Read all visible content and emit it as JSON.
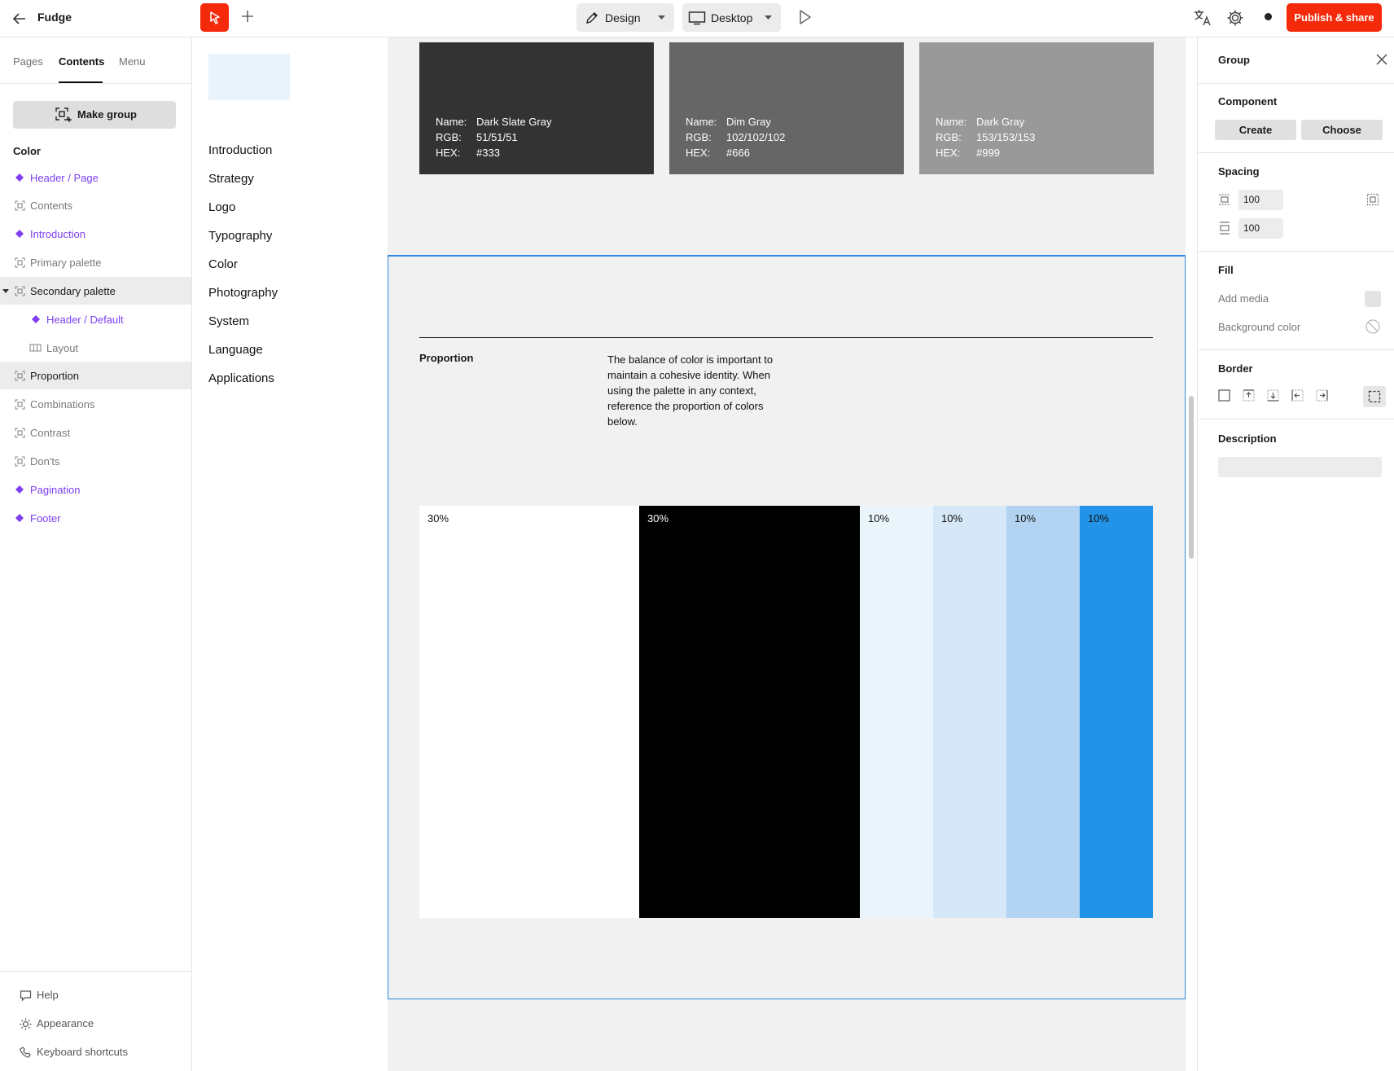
{
  "app": {
    "title": "Fudge"
  },
  "toolbar": {
    "design_label": "Design",
    "desktop_label": "Desktop",
    "publish_label": "Publish & share"
  },
  "sidebar": {
    "tabs": [
      {
        "label": "Pages"
      },
      {
        "label": "Contents"
      },
      {
        "label": "Menu"
      }
    ],
    "active_tab": "Contents",
    "make_group_label": "Make group",
    "section_label": "Color",
    "items": [
      {
        "label": "Header / Page",
        "kind": "component"
      },
      {
        "label": "Contents",
        "kind": "group"
      },
      {
        "label": "Introduction",
        "kind": "component"
      },
      {
        "label": "Primary palette",
        "kind": "group"
      },
      {
        "label": "Secondary palette",
        "kind": "group",
        "expanded": true
      },
      {
        "label": "Header / Default",
        "kind": "component"
      },
      {
        "label": "Layout",
        "kind": "layout"
      },
      {
        "label": "Proportion",
        "kind": "group",
        "selected": true
      },
      {
        "label": "Combinations",
        "kind": "group"
      },
      {
        "label": "Contrast",
        "kind": "group"
      },
      {
        "label": "Don'ts",
        "kind": "group"
      },
      {
        "label": "Pagination",
        "kind": "component"
      },
      {
        "label": "Footer",
        "kind": "component"
      }
    ],
    "bottom": [
      {
        "label": "Help",
        "icon": "help-icon"
      },
      {
        "label": "Appearance",
        "icon": "sun-icon"
      },
      {
        "label": "Keyboard shortcuts",
        "icon": "keyboard-icon"
      }
    ]
  },
  "site_nav": {
    "links": [
      "Introduction",
      "Strategy",
      "Logo",
      "Typography",
      "Color",
      "Photography",
      "System",
      "Language",
      "Applications"
    ]
  },
  "swatches": [
    {
      "name": "Dark Slate Gray",
      "rgb": "51/51/51",
      "hex": "#333",
      "color": "#333333"
    },
    {
      "name": "Dim Gray",
      "rgb": "102/102/102",
      "hex": "#666",
      "color": "#666666"
    },
    {
      "name": "Dark Gray",
      "rgb": "153/153/153",
      "hex": "#999",
      "color": "#999999"
    }
  ],
  "swatch_keys": {
    "name": "Name:",
    "rgb": "RGB:",
    "hex": "HEX:"
  },
  "proportion": {
    "title": "Proportion",
    "text": "The balance of color is important to maintain a cohesive identity. When using the palette in any context, reference the proportion of colors below.",
    "bars": [
      {
        "label": "30%",
        "share": 30,
        "color": "#ffffff",
        "text_color": "#111111"
      },
      {
        "label": "30%",
        "share": 30,
        "color": "#000000",
        "text_color": "#ffffff"
      },
      {
        "label": "10%",
        "share": 10,
        "color": "#eaf4fb",
        "text_color": "#111111"
      },
      {
        "label": "10%",
        "share": 10,
        "color": "#d6e8f7",
        "text_color": "#111111"
      },
      {
        "label": "10%",
        "share": 10,
        "color": "#b2d4f2",
        "text_color": "#111111"
      },
      {
        "label": "10%",
        "share": 10,
        "color": "#2293e6",
        "text_color": "#111111"
      }
    ]
  },
  "panel": {
    "title": "Group",
    "component_label": "Component",
    "create_label": "Create",
    "choose_label": "Choose",
    "spacing_label": "Spacing",
    "spacing_gap": "100",
    "spacing_padding": "100",
    "fill_label": "Fill",
    "add_media_label": "Add media",
    "background_color_label": "Background color",
    "border_label": "Border",
    "description_label": "Description"
  },
  "colors": {
    "accent": "#f52a0a",
    "selection": "#2d8ce0",
    "component": "#7d3ff0"
  }
}
